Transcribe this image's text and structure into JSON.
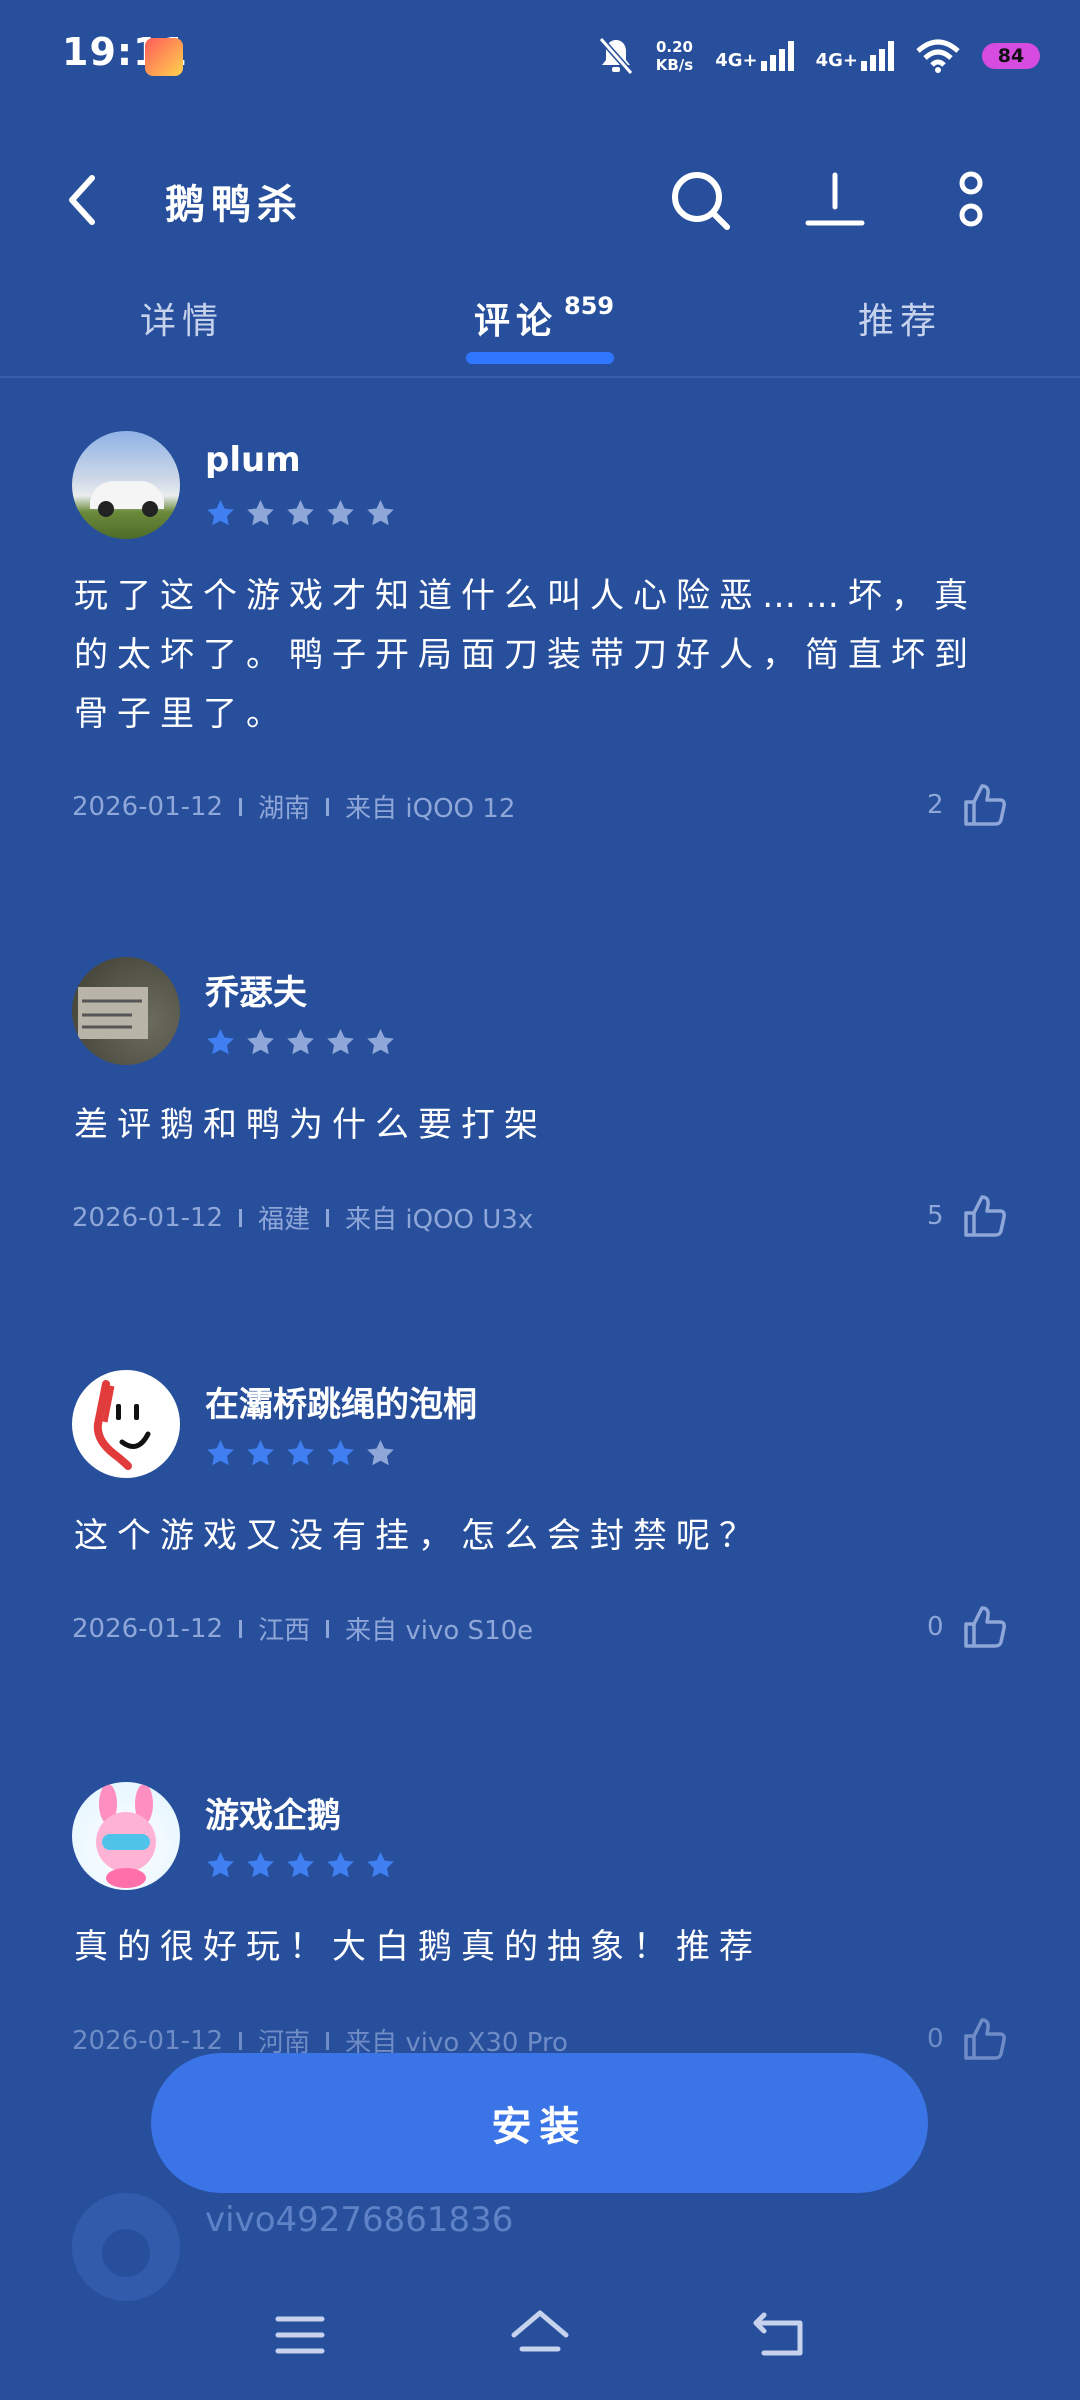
{
  "status_bar": {
    "time": "19:11",
    "net_speed_value": "0.20",
    "net_speed_unit": "KB/s",
    "network_1": "4G+",
    "network_2": "4G+",
    "battery": "84"
  },
  "header": {
    "title": "鹅鸭杀",
    "icons": [
      "back-icon",
      "search-icon",
      "download-icon",
      "more-icon"
    ]
  },
  "tabs": [
    {
      "label": "详情"
    },
    {
      "label": "评论",
      "count": "859"
    },
    {
      "label": "推荐"
    }
  ],
  "colors": {
    "background": "#274f9c",
    "accent": "#2f77ff",
    "button": "#3b74e6",
    "star_on": "#3f7ff2",
    "star_off": "#8ea6d8"
  },
  "reviews": [
    {
      "user": "plum",
      "rating": 1,
      "text": "玩了这个游戏才知道什么叫人心险恶……坏，真的太坏了。鸭子开局面刀装带刀好人，简直坏到骨子里了。",
      "date": "2026-01-12",
      "region": "湖南",
      "device": "来自 iQOO 12",
      "likes": "2"
    },
    {
      "user": "乔瑟夫",
      "rating": 1,
      "text": "差评鹅和鸭为什么要打架",
      "date": "2026-01-12",
      "region": "福建",
      "device": "来自 iQOO U3x",
      "likes": "5"
    },
    {
      "user": "在灞桥跳绳的泡桐",
      "rating": 4,
      "text": "这个游戏又没有挂，怎么会封禁呢？",
      "date": "2026-01-12",
      "region": "江西",
      "device": "来自 vivo S10e",
      "likes": "0"
    },
    {
      "user": "游戏企鹅",
      "rating": 5,
      "text": "真的很好玩！大白鹅真的抽象！推荐",
      "date": "2026-01-12",
      "region": "河南",
      "device": "来自 vivo X30 Pro",
      "likes": "0"
    },
    {
      "user": "vivo49276861836"
    }
  ],
  "install_button": "安装",
  "nav": [
    "menu-icon",
    "home-icon",
    "back-nav-icon"
  ]
}
